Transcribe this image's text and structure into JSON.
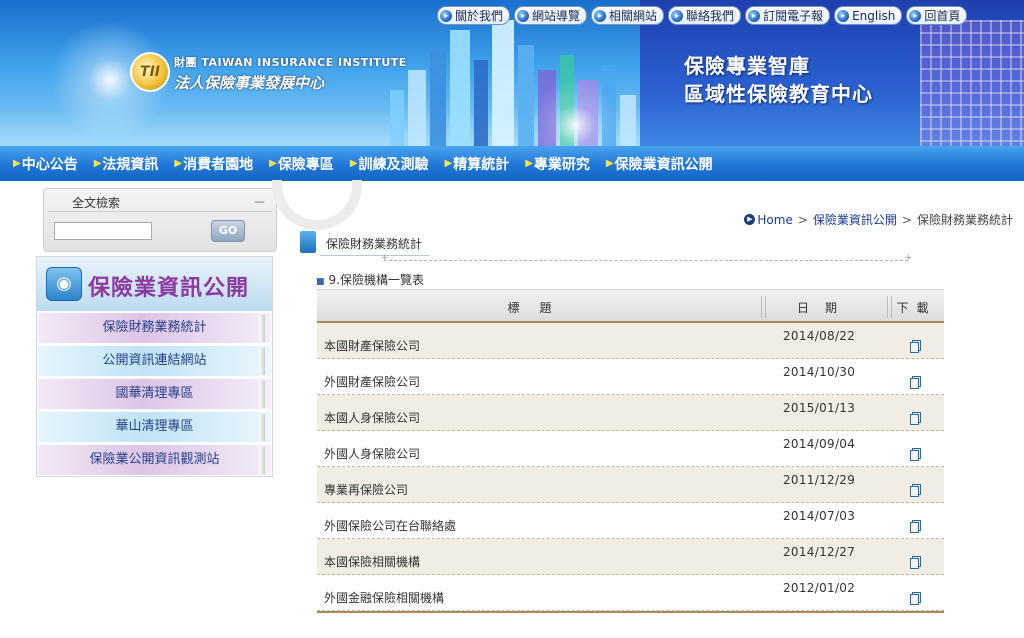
{
  "header": {
    "logo_line1": "財團 TAIWAN INSURANCE INSTITUTE",
    "logo_line2": "法人保險事業發展中心",
    "logo_mark": "TII",
    "slogan_line1": "保險專業智庫",
    "slogan_line2": "區域性保險教育中心"
  },
  "toplinks": [
    "關於我們",
    "網站導覽",
    "相關網站",
    "聯絡我們",
    "訂閱電子報",
    "English",
    "回首頁"
  ],
  "mainnav": [
    "中心公告",
    "法規資訊",
    "消費者園地",
    "保險專區",
    "訓練及測驗",
    "精算統計",
    "專業研究",
    "保險業資訊公開"
  ],
  "search": {
    "title": "全文檢索",
    "collapse": "－",
    "value": "",
    "go_label": "GO"
  },
  "sidebar": {
    "title": "保險業資訊公開",
    "items": [
      "保險財務業務統計",
      "公開資訊連結網站",
      "國華清理專區",
      "華山清理專區",
      "保險業公開資訊觀測站"
    ]
  },
  "breadcrumb": {
    "home": "Home",
    "level1": "保險業資訊公開",
    "level2": "保險財務業務統計",
    "separator": ">"
  },
  "section_title": "保險財務業務統計",
  "subheading": "9.保險機構一覽表",
  "table": {
    "headers": {
      "title": "標題",
      "date": "日期",
      "download": "下載"
    },
    "rows": [
      {
        "title": "本國財產保險公司",
        "date": "2014/08/22"
      },
      {
        "title": "外國財產保險公司",
        "date": "2014/10/30"
      },
      {
        "title": "本國人身保險公司",
        "date": "2015/01/13"
      },
      {
        "title": "外國人身保險公司",
        "date": "2014/09/04"
      },
      {
        "title": "專業再保險公司",
        "date": "2011/12/29"
      },
      {
        "title": "外國保險公司在台聯絡處",
        "date": "2014/07/03"
      },
      {
        "title": "本國保險相關機構",
        "date": "2014/12/27"
      },
      {
        "title": "外國金融保險相關機構",
        "date": "2012/01/02"
      }
    ]
  },
  "icons": {
    "nav_bullet": "triangle-right-icon",
    "toplink_bullet": "arrow-circle-icon",
    "download": "document-copy-icon",
    "home": "home-circle-icon"
  }
}
